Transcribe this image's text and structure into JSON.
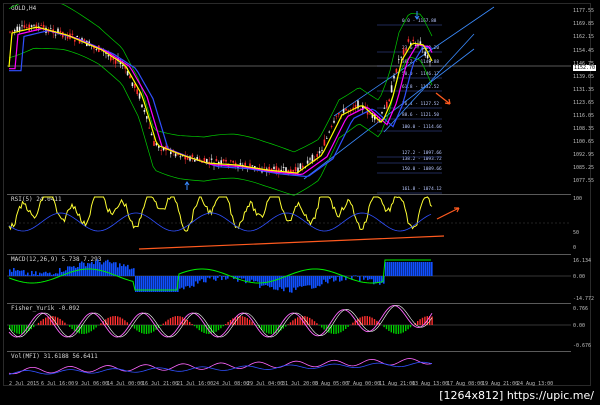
{
  "main_chart": {
    "title": "GOLD,H4",
    "price_ticks": [
      "1177.55",
      "1169.85",
      "1162.15",
      "1154.45",
      "1146.75",
      "1139.05",
      "1131.35",
      "1123.65",
      "1116.05",
      "1108.35",
      "1100.65",
      "1092.95",
      "1085.25",
      "1077.55"
    ],
    "current_price": "1152.70",
    "fib_levels": [
      {
        "label": "0.0 - 1167.88"
      },
      {
        "label": "23.6 - 1162.20"
      },
      {
        "label": "38.2 - 1149.88"
      },
      {
        "label": "50.0 - 1146.17"
      },
      {
        "label": "61.8 - 1132.52"
      },
      {
        "label": "76.4 - 1127.52"
      },
      {
        "label": "88.6 - 1121.50"
      },
      {
        "label": "100.0 - 1114.66"
      },
      {
        "label": "127.2 - 1097.66"
      },
      {
        "label": "138.2 - 1093.72"
      },
      {
        "label": "150.0 - 1089.66"
      },
      {
        "label": "161.8 - 1074.12"
      }
    ]
  },
  "rsi_panel": {
    "title": "RSI(5) 24.0411",
    "ticks": [
      "100",
      "50",
      "0"
    ]
  },
  "macd_panel": {
    "title": "MACD(12,26,9) 5.738 7.293",
    "ticks": [
      "16.134",
      "0.00",
      "-14.772"
    ]
  },
  "fisher_panel": {
    "title": "Fisher_Yurik -0.092",
    "ticks": [
      "0.766",
      "0.00",
      "-0.676"
    ]
  },
  "vol_panel": {
    "title": "Vol(MFI) 31.6188 56.6411",
    "ticks": [
      "",
      ""
    ]
  },
  "time_axis": [
    "2 Jul 2015",
    "6 Jul 16:00",
    "9 Jul 06:00",
    "14 Jul 00:00",
    "16 Jul 21:00",
    "21 Jul 16:00",
    "24 Jul 08:00",
    "29 Jul 04:00",
    "31 Jul 20:00",
    "5 Aug 05:00",
    "7 Aug 00:00",
    "11 Aug 21:00",
    "13 Aug 13:00",
    "17 Aug 08:00",
    "19 Aug 21:00",
    "24 Aug 13:00"
  ],
  "watermark": "[1264x812] https://upic.me/",
  "colors": {
    "background": "#000000",
    "bull_candle": "#f0f0f0",
    "bear_candle": "#ff3030",
    "ma_fast": "#ffff00",
    "ma_mid": "#ff00ff",
    "ma_slow": "#3050ff",
    "bands": "#00cc00",
    "channel": "#3a8bff",
    "annotation_arrow": "#ff5a1f"
  }
}
